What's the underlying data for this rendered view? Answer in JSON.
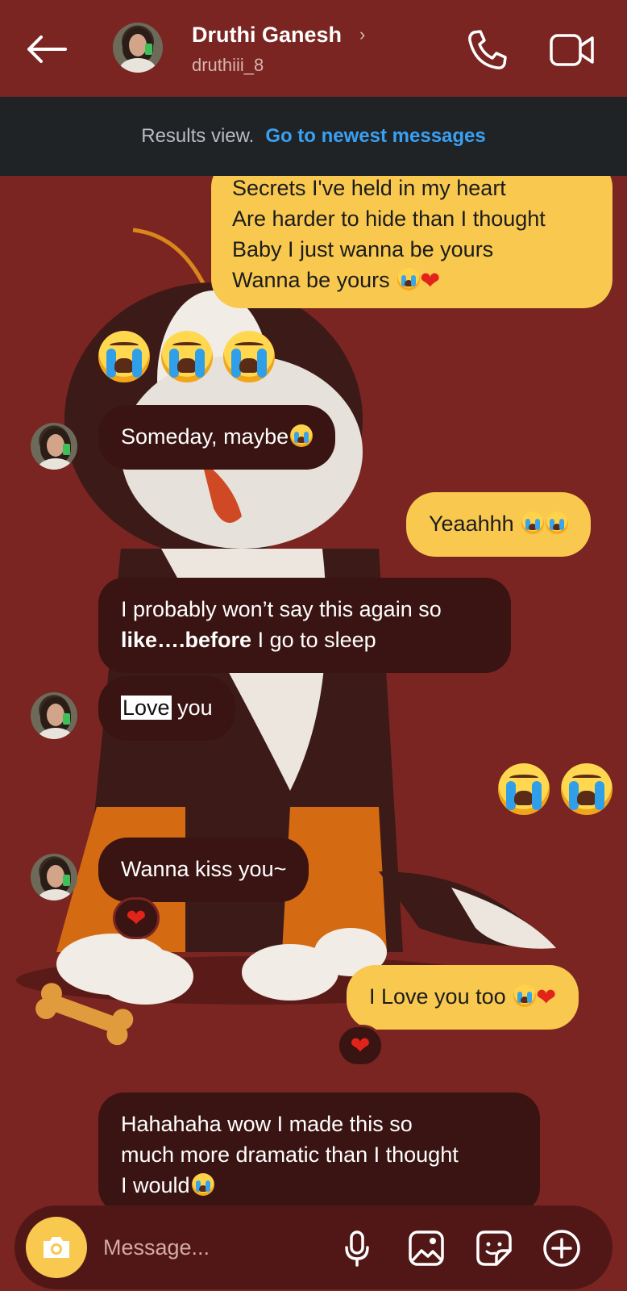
{
  "header": {
    "name": "Druthi Ganesh",
    "username": "druthiii_8",
    "chevron": "›",
    "icons": {
      "back": "back-arrow-icon",
      "call": "phone-icon",
      "video": "video-camera-icon"
    }
  },
  "banner": {
    "prefix": "Results view.",
    "link": "Go to newest messages"
  },
  "messages": {
    "m1": {
      "lines": [
        "Secrets I've held in my heart",
        "Are harder to hide than I thought",
        "Baby I just wanna be yours",
        "Wanna be yours"
      ]
    },
    "m3": {
      "text": "Someday, maybe"
    },
    "m4": {
      "text": "Yeaahhh"
    },
    "m5": {
      "line1": "I probably won’t say this again so",
      "bold": "like….before",
      "rest": " I go to sleep"
    },
    "m6": {
      "highlight": "Love",
      "rest": " you"
    },
    "m8": {
      "text": "Wanna kiss you~"
    },
    "m9": {
      "text": "I Love you too"
    },
    "m10": {
      "lines": [
        "Hahahaha wow I made this so",
        "much more dramatic than I thought",
        "I would"
      ]
    },
    "reaction_emoji": "❤"
  },
  "composer": {
    "placeholder": "Message...",
    "icons": {
      "camera": "camera-icon",
      "mic": "microphone-icon",
      "gallery": "gallery-icon",
      "sticker": "sticker-icon",
      "add": "plus-circle-icon"
    }
  },
  "colors": {
    "background": "#7a2521",
    "outgoing_bubble": "#f8c84f",
    "incoming_bubble": "#3a1412",
    "banner": "#1f2326",
    "link": "#3aa0f2"
  }
}
